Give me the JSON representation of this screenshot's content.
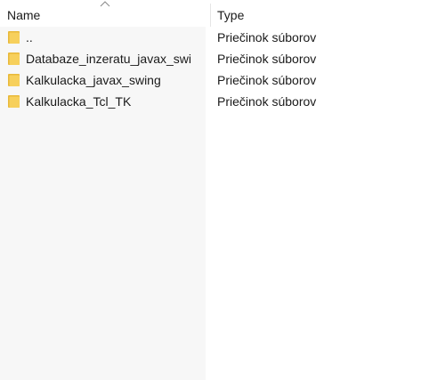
{
  "columns": {
    "name": "Name",
    "type": "Type"
  },
  "sort_indicator_icon": "chevron-up-icon",
  "folder_icon": "folder-icon",
  "colors": {
    "folder": "#f2c84b",
    "name_column_bg": "#f7f7f7"
  },
  "rows": [
    {
      "name": "..",
      "type": "Priečinok súborov"
    },
    {
      "name": "Databaze_inzeratu_javax_swi",
      "type": "Priečinok súborov"
    },
    {
      "name": "Kalkulacka_javax_swing",
      "type": "Priečinok súborov"
    },
    {
      "name": "Kalkulacka_Tcl_TK",
      "type": "Priečinok súborov"
    }
  ]
}
